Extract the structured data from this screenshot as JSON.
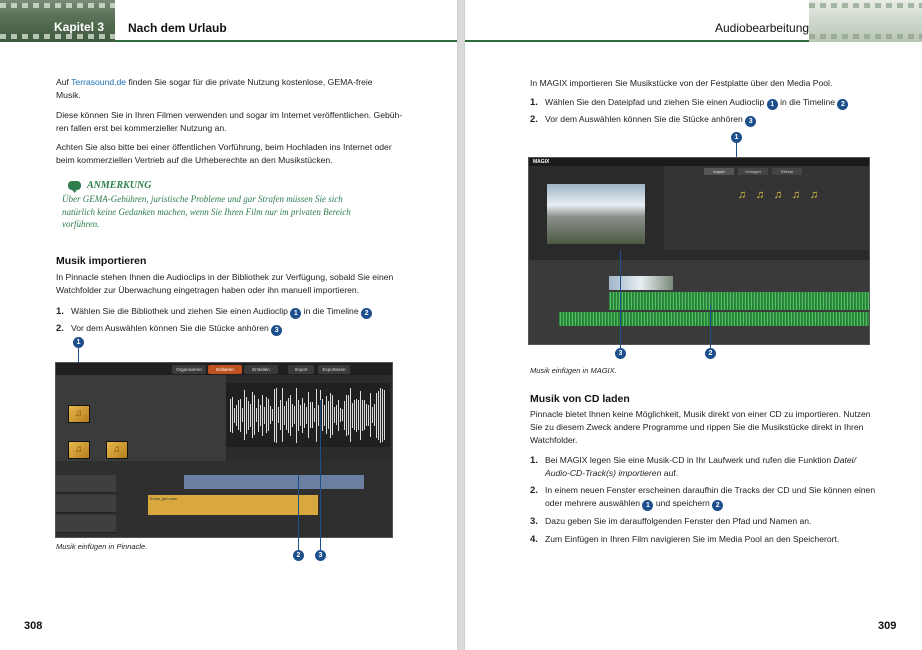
{
  "left_page": {
    "chapter_label": "Kapitel 3",
    "chapter_title": "Nach dem Urlaub",
    "para1_prefix": "Auf ",
    "para1_link": "Terrasound.de",
    "para1_line1_rest": " finden Sie sogar für die private Nutzung kostenlose, GEMA-freie",
    "para1_line2": "Musik.",
    "para2_line1": "Diese können Sie in Ihren Filmen verwenden und sogar im Internet veröffentlichen. Gebüh-",
    "para2_line2": "ren fallen erst bei kommerzieller Nutzung an.",
    "para3_line1": "Achten Sie also bitte bei einer öffentlichen Vorführung, beim Hochladen ins Internet oder",
    "para3_line2": "beim kommerziellen Vertrieb auf die Urheberechte an den Musikstücken.",
    "note_heading": "ANMERKUNG",
    "note_line1": "Über GEMA-Gebühren, juristische Probleme und gar Strafen müssen Sie sich",
    "note_line2": "natürlich keine Gedanken machen, wenn Sie Ihren Film nur im privaten Bereich",
    "note_line3": "vorführen.",
    "heading": "Musik importieren",
    "intro_line1": "In Pinnacle stehen Ihnen die Audioclips in der Bibliothek zur Verfügung, sobald Sie einen",
    "intro_line2": "Watchfolder zur Überwachung eingetragen haben oder ihn manuell importieren.",
    "step1_num": "1.",
    "step1_a": "Wählen Sie die Bibliothek und ziehen Sie einen Audioclip ",
    "step1_b": " in die Timeline ",
    "step2_num": "2.",
    "step2_a": "Vor dem Auswählen können Sie die Stücke anhören ",
    "caption": "Musik einfügen in Pinnacle.",
    "page_number": "308",
    "callouts": [
      "1",
      "2",
      "3"
    ],
    "screenshot": {
      "tabs": [
        "Organisieren",
        "Editieren",
        "Erstellen"
      ],
      "buttons": [
        "Import",
        "Exportieren"
      ],
      "clip_label": "Ennis_jam.wav"
    }
  },
  "right_page": {
    "section_title": "Audiobearbeitung",
    "intro": "In MAGIX importieren Sie Musikstücke von der Festplatte über den Media Pool.",
    "step1_num": "1.",
    "step1_a": "Wählen Sie den Dateipfad und ziehen Sie einen Audioclip ",
    "step1_b": " in die Timeline ",
    "step2_num": "2.",
    "step2_a": "Vor dem Auswählen können Sie die Stücke anhören ",
    "caption": "Musik einfügen in MAGIX.",
    "heading": "Musik von CD laden",
    "cd_line1": "Pinnacle bietet Ihnen keine Möglichkeit, Musik direkt von einer CD zu importieren. Nutzen",
    "cd_line2": "Sie zu diesem Zweck andere Programme und rippen Sie die Musikstücke direkt in Ihren",
    "cd_line3": "Watchfolder.",
    "cd_step1_num": "1.",
    "cd_step1_line1": "Bei MAGIX legen Sie eine Musik-CD in Ihr Laufwerk und rufen die Funktion ",
    "cd_step1_italic1": "Datei/",
    "cd_step1_italic2": "Audio-CD-Track(s) importieren",
    "cd_step1_end": " auf.",
    "cd_step2_num": "2.",
    "cd_step2_line1": "In einem neuen Fenster erscheinen daraufhin die Tracks der CD und Sie können einen",
    "cd_step2_line2a": "oder mehrere auswählen ",
    "cd_step2_line2b": " und speichern ",
    "cd_step3_num": "3.",
    "cd_step3": "Dazu geben Sie im darauffolgenden Fenster den Pfad und Namen an.",
    "cd_step4_num": "4.",
    "cd_step4": "Zum Einfügen in Ihren Film navigieren Sie im Media Pool an den Speicherort.",
    "page_number": "309",
    "callouts": [
      "1",
      "2",
      "3"
    ],
    "screenshot": {
      "app_name": "MAGIX",
      "tabs": [
        "Import",
        "Vorlagen",
        "Effekte"
      ]
    }
  }
}
